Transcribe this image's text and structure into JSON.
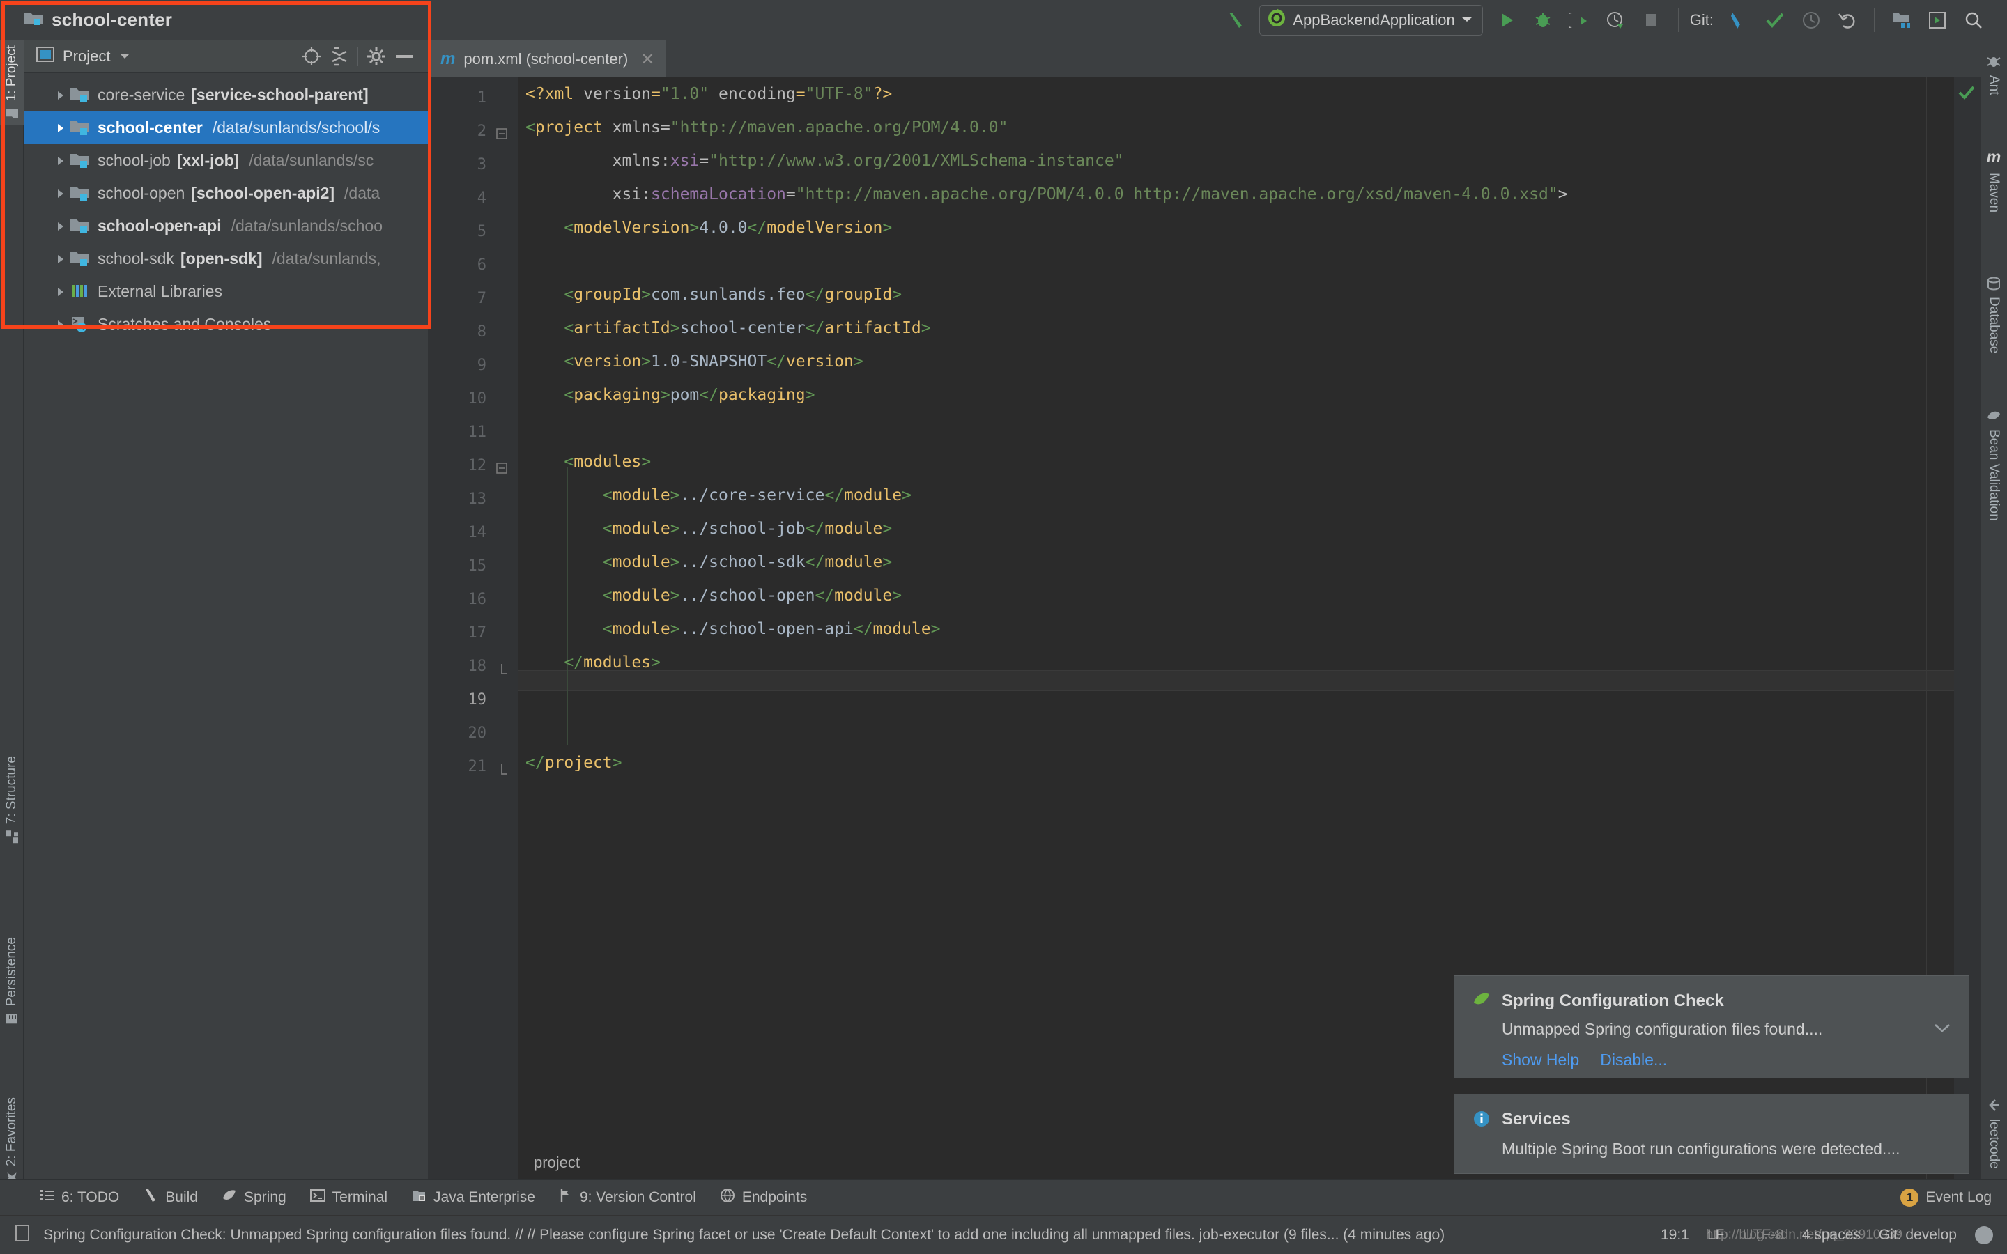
{
  "toolbar": {
    "project_name": "school-center",
    "run_config": "AppBackendApplication",
    "git_label": "Git:",
    "icons": [
      "build-hammer-icon",
      "run-icon",
      "debug-icon",
      "run-coverage-icon",
      "profiler-icon",
      "stop-icon",
      "git-update-icon",
      "git-commit-icon",
      "git-history-icon",
      "git-rollback-icon",
      "project-structure-icon",
      "settings-icon",
      "search-everywhere-icon"
    ]
  },
  "project_panel": {
    "title": "Project",
    "header_icons": [
      "locate-icon",
      "collapse-all-icon",
      "gear-icon",
      "hide-icon"
    ],
    "tree": [
      {
        "name": "core-service",
        "module": "[service-school-parent]",
        "path": "",
        "bold_name": false,
        "selected": false
      },
      {
        "name": "school-center",
        "module": "",
        "path": "/data/sunlands/school/s",
        "bold_name": true,
        "selected": true
      },
      {
        "name": "school-job",
        "module": "[xxl-job]",
        "path": "/data/sunlands/sc",
        "bold_name": false,
        "selected": false
      },
      {
        "name": "school-open",
        "module": "[school-open-api2]",
        "path": "/data",
        "bold_name": false,
        "selected": false
      },
      {
        "name": "school-open-api",
        "module": "",
        "path": "/data/sunlands/schoo",
        "bold_name": true,
        "selected": false
      },
      {
        "name": "school-sdk",
        "module": "[open-sdk]",
        "path": "/data/sunlands,",
        "bold_name": false,
        "selected": false
      },
      {
        "name": "External Libraries",
        "module": "",
        "path": "",
        "bold_name": false,
        "selected": false,
        "icon": "libraries-icon"
      },
      {
        "name": "Scratches and Consoles",
        "module": "",
        "path": "",
        "bold_name": false,
        "selected": false,
        "icon": "scratches-icon"
      }
    ]
  },
  "left_tool_tabs": [
    {
      "label": "1: Project",
      "icon": "project-icon",
      "selected": true
    },
    {
      "label": "7: Structure",
      "icon": "structure-icon",
      "selected": false
    },
    {
      "label": "Persistence",
      "icon": "persistence-icon",
      "selected": false
    },
    {
      "label": "2: Favorites",
      "icon": "favorites-star-icon",
      "selected": false
    }
  ],
  "right_tool_tabs": [
    {
      "label": "Ant",
      "icon": "ant-icon"
    },
    {
      "label": "Maven",
      "icon": "maven-icon"
    },
    {
      "label": "Database",
      "icon": "database-icon"
    },
    {
      "label": "Bean Validation",
      "icon": "bean-validation-icon"
    },
    {
      "label": "leetcode",
      "icon": "leetcode-icon"
    }
  ],
  "editor": {
    "tab_label": "pom.xml (school-center)",
    "tab_icon": "maven-m-icon",
    "breadcrumb": "project",
    "caret_line": 19,
    "inspection_status": "ok",
    "lines": [
      {
        "n": 1,
        "fold": false
      },
      {
        "n": 2,
        "fold": true
      },
      {
        "n": 3,
        "fold": false
      },
      {
        "n": 4,
        "fold": false
      },
      {
        "n": 5,
        "fold": false
      },
      {
        "n": 6,
        "fold": false
      },
      {
        "n": 7,
        "fold": false
      },
      {
        "n": 8,
        "fold": false
      },
      {
        "n": 9,
        "fold": false
      },
      {
        "n": 10,
        "fold": false
      },
      {
        "n": 11,
        "fold": false
      },
      {
        "n": 12,
        "fold": true
      },
      {
        "n": 13,
        "fold": false
      },
      {
        "n": 14,
        "fold": false
      },
      {
        "n": 15,
        "fold": false
      },
      {
        "n": 16,
        "fold": false
      },
      {
        "n": 17,
        "fold": false
      },
      {
        "n": 18,
        "fold": true
      },
      {
        "n": 19,
        "fold": false
      },
      {
        "n": 20,
        "fold": false
      },
      {
        "n": 21,
        "fold": true
      }
    ],
    "code_text": {
      "l1": "<?xml version=\"1.0\" encoding=\"UTF-8\"?>",
      "l2": "<project xmlns=\"http://maven.apache.org/POM/4.0.0\"",
      "l3": "         xmlns:xsi=\"http://www.w3.org/2001/XMLSchema-instance\"",
      "l4": "         xsi:schemaLocation=\"http://maven.apache.org/POM/4.0.0 http://maven.apache.org/xsd/maven-4.0.0.xsd\">",
      "l5": "    <modelVersion>4.0.0</modelVersion>",
      "l6": "",
      "l7": "    <groupId>com.sunlands.feo</groupId>",
      "l8": "    <artifactId>school-center</artifactId>",
      "l9": "    <version>1.0-SNAPSHOT</version>",
      "l10": "    <packaging>pom</packaging>",
      "l11": "",
      "l12": "    <modules>",
      "l13": "        <module>../core-service</module>",
      "l14": "        <module>../school-job</module>",
      "l15": "        <module>../school-sdk</module>",
      "l16": "        <module>../school-open</module>",
      "l17": "        <module>../school-open-api</module>",
      "l18": "    </modules>",
      "l19": "",
      "l20": "",
      "l21": "</project>"
    }
  },
  "notifications": [
    {
      "title": "Spring Configuration Check",
      "icon": "spring-leaf-icon",
      "body": "Unmapped Spring configuration files found....",
      "links": [
        "Show Help",
        "Disable..."
      ],
      "collapse_icon": "chevron-down-icon"
    },
    {
      "title": "Services",
      "icon": "info-icon",
      "body": "Multiple Spring Boot run configurations were detected....",
      "links": []
    }
  ],
  "bottom_bar": {
    "items": [
      {
        "label": "6: TODO",
        "underline": "6",
        "icon": "todo-icon"
      },
      {
        "label": "Build",
        "underline": "",
        "icon": "build-hammer-icon"
      },
      {
        "label": "Spring",
        "underline": "",
        "icon": "spring-leaf-icon"
      },
      {
        "label": "Terminal",
        "underline": "",
        "icon": "terminal-icon"
      },
      {
        "label": "Java Enterprise",
        "underline": "",
        "icon": "java-enterprise-icon"
      },
      {
        "label": "9: Version Control",
        "underline": "9",
        "icon": "version-control-icon"
      },
      {
        "label": "Endpoints",
        "underline": "",
        "icon": "endpoints-icon"
      }
    ],
    "event_log": {
      "label": "Event Log",
      "count": "1",
      "icon": "event-log-icon"
    }
  },
  "status_bar": {
    "message": "Spring Configuration Check: Unmapped Spring configuration files found. // // Please configure Spring facet or use 'Create Default Context' to add one including all unmapped files. job-executor (9 files... (4 minutes ago)",
    "caret": "19:1",
    "line_sep": "LF",
    "encoding": "UTF-8",
    "indent": "4 spaces",
    "branch": "Git: develop",
    "url": "http://blog.csdn.net/qq_33910939",
    "icons": [
      "memory-icon",
      "branch-icon",
      "avatar"
    ]
  },
  "colors": {
    "accent_blue": "#2675bf",
    "highlight_red": "#f6431b",
    "link_blue": "#4e9bf0",
    "panel_bg": "#3c3f41",
    "editor_bg": "#2b2b2b",
    "green": "#499c54"
  }
}
